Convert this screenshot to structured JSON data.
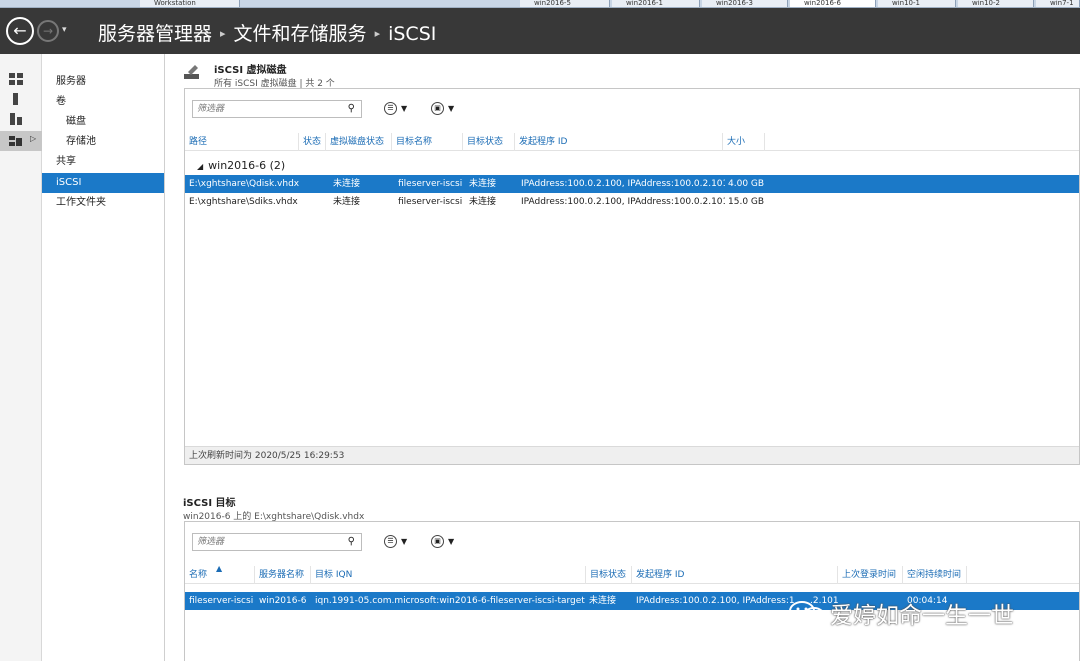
{
  "browser_tabs": [
    "Workstation",
    "win2016-5",
    "win2016-1",
    "win2016-3",
    "win2016-6",
    "win10-1",
    "win10-2",
    "win7-1"
  ],
  "header": {
    "back_symbol": "←",
    "forward_symbol": "→",
    "dropdown_symbol": "▾",
    "breadcrumb": [
      "服务器管理器",
      "文件和存储服务",
      "iSCSI"
    ],
    "separator": "▸"
  },
  "nav": {
    "items": [
      {
        "label": "服务器",
        "level": 0
      },
      {
        "label": "卷",
        "level": 0
      },
      {
        "label": "磁盘",
        "level": 1
      },
      {
        "label": "存储池",
        "level": 1
      },
      {
        "label": "共享",
        "level": 0
      },
      {
        "label": "iSCSI",
        "level": 0,
        "selected": true
      },
      {
        "label": "工作文件夹",
        "level": 0
      }
    ]
  },
  "vdisk_section": {
    "title": "iSCSI 虚拟磁盘",
    "subtitle": "所有 iSCSI 虚拟磁盘 | 共 2 个",
    "filter_placeholder": "筛选器",
    "search_symbol": "⚲",
    "columns": [
      "路径",
      "状态",
      "虚拟磁盘状态",
      "目标名称",
      "目标状态",
      "发起程序 ID",
      "大小"
    ],
    "group_label": "win2016-6 (2)",
    "group_toggle": "◢",
    "rows": [
      {
        "path": "E:\\xghtshare\\Qdisk.vhdx",
        "status": "",
        "vdisk_status": "未连接",
        "target": "fileserver-iscsi",
        "target_status": "未连接",
        "initiator": "IPAddress:100.0.2.100, IPAddress:100.0.2.101",
        "size": "4.00 GB",
        "selected": true
      },
      {
        "path": "E:\\xghtshare\\Sdiks.vhdx",
        "status": "",
        "vdisk_status": "未连接",
        "target": "fileserver-iscsi",
        "target_status": "未连接",
        "initiator": "IPAddress:100.0.2.100, IPAddress:100.0.2.101",
        "size": "15.0 GB",
        "selected": false
      }
    ],
    "status_text": "上次刷新时间为 2020/5/25 16:29:53"
  },
  "target_section": {
    "title": "iSCSI 目标",
    "subtitle": "win2016-6 上的 E:\\xghtshare\\Qdisk.vhdx",
    "filter_placeholder": "筛选器",
    "search_symbol": "⚲",
    "sort_symbol": "▲",
    "columns": [
      "名称",
      "服务器名称",
      "目标 IQN",
      "目标状态",
      "发起程序 ID",
      "上次登录时间",
      "空闲持续时间"
    ],
    "rows": [
      {
        "name": "fileserver-iscsi",
        "server": "win2016-6",
        "iqn": "iqn.1991-05.com.microsoft:win2016-6-fileserver-iscsi-target",
        "status": "未连接",
        "initiator": "IPAddress:100.0.2.100, IPAddress:1",
        "initiator_tail": ".2.101",
        "last_login": "",
        "idle": "00:04:14",
        "selected": true
      }
    ]
  },
  "watermark": {
    "text": "爱婷如命一生一世"
  },
  "colors": {
    "selection": "#1b79c8",
    "titlebar": "#383838",
    "column_header": "#1b6cb5"
  }
}
